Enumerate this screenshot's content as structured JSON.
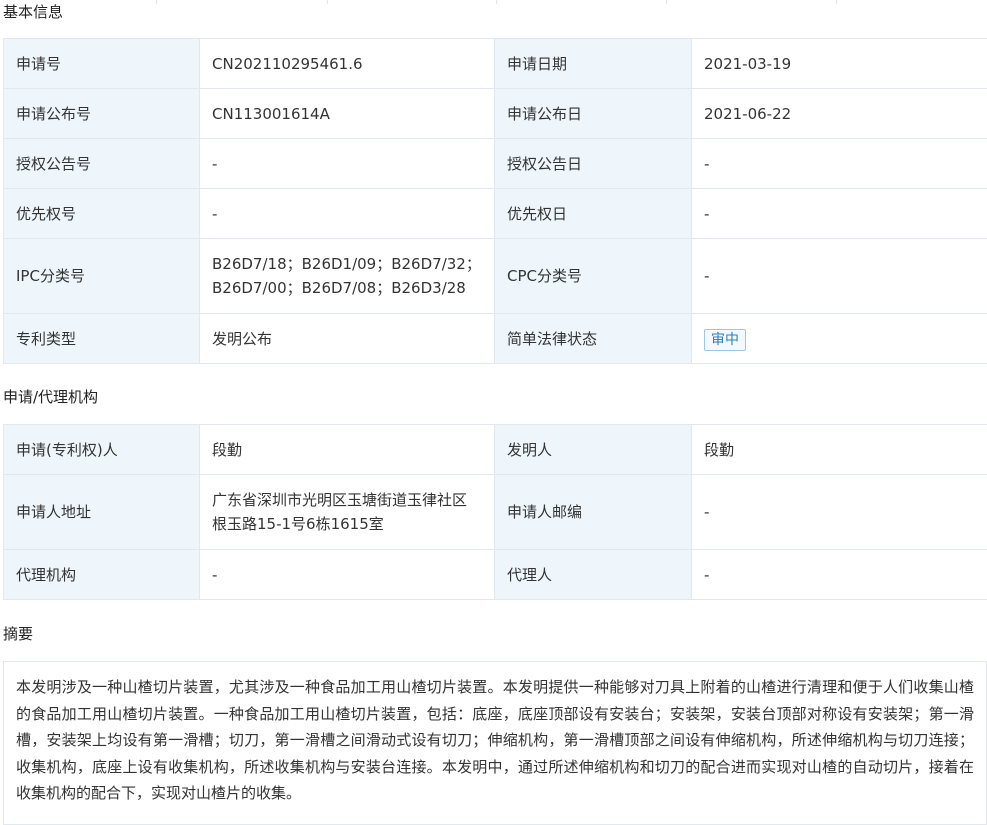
{
  "basic_info": {
    "title": "基本信息",
    "rows": [
      {
        "label1": "申请号",
        "value1": "CN202110295461.6",
        "label2": "申请日期",
        "value2": "2021-03-19"
      },
      {
        "label1": "申请公布号",
        "value1": "CN113001614A",
        "label2": "申请公布日",
        "value2": "2021-06-22"
      },
      {
        "label1": "授权公告号",
        "value1": "-",
        "label2": "授权公告日",
        "value2": "-"
      },
      {
        "label1": "优先权号",
        "value1": "-",
        "label2": "优先权日",
        "value2": "-"
      },
      {
        "label1": "IPC分类号",
        "value1_line1": "B26D7/18；B26D1/09；B26D7/32；",
        "value1_line2": "B26D7/00；B26D7/08；B26D3/28",
        "label2": "CPC分类号",
        "value2": "-"
      },
      {
        "label1": "专利类型",
        "value1": "发明公布",
        "label2": "简单法律状态",
        "value2": "审中"
      }
    ]
  },
  "agency": {
    "title": "申请/代理机构",
    "rows": [
      {
        "label1": "申请(专利权)人",
        "value1": "段勤",
        "label2": "发明人",
        "value2": "段勤"
      },
      {
        "label1": "申请人地址",
        "value1_line1": "广东省深圳市光明区玉塘街道玉律社区",
        "value1_line2": "根玉路15-1号6栋1615室",
        "label2": "申请人邮编",
        "value2": "-"
      },
      {
        "label1": "代理机构",
        "value1": "-",
        "label2": "代理人",
        "value2": "-"
      }
    ]
  },
  "abstract": {
    "title": "摘要",
    "text": "本发明涉及一种山楂切片装置，尤其涉及一种食品加工用山楂切片装置。本发明提供一种能够对刀具上附着的山楂进行清理和便于人们收集山楂的食品加工用山楂切片装置。一种食品加工用山楂切片装置，包括：底座，底座顶部设有安装台；安装架，安装台顶部对称设有安装架；第一滑槽，安装架上均设有第一滑槽；切刀，第一滑槽之间滑动式设有切刀；伸缩机构，第一滑槽顶部之间设有伸缩机构，所述伸缩机构与切刀连接；收集机构，底座上设有收集机构，所述收集机构与安装台连接。本发明中，通过所述伸缩机构和切刀的配合进而实现对山楂的自动切片，接着在收集机构的配合下，实现对山楂片的收集。"
  },
  "colors": {
    "label_bg": "#eef6fb",
    "border": "#e3e8ee",
    "tag_border": "#9cc6e6",
    "tag_text": "#2c7cc4"
  }
}
